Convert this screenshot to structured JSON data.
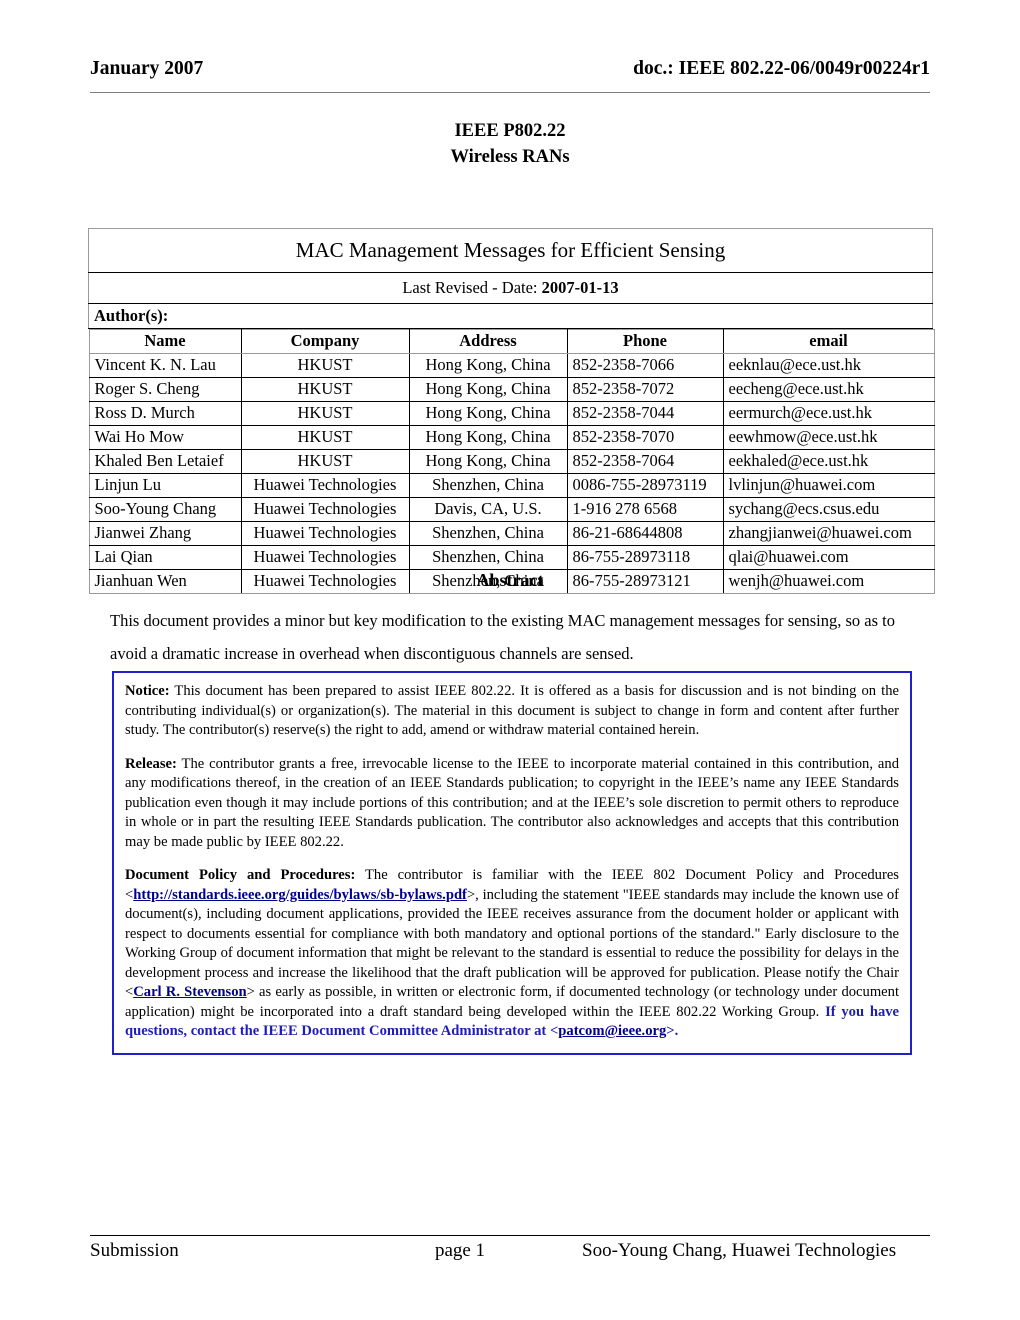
{
  "header": {
    "left": "January 2007",
    "right": "doc.: IEEE 802.22-06/0049r00224r1"
  },
  "series": {
    "line1": "IEEE P802.22",
    "line2": "Wireless RANs"
  },
  "title_block": {
    "title": "MAC Management Messages for Efficient Sensing",
    "revised_label": "Last Revised - Date: ",
    "revised_date": "2007-01-13",
    "authors_label": "Author(s):"
  },
  "authors_table": {
    "columns": [
      "Name",
      "Company",
      "Address",
      "Phone",
      "email"
    ],
    "rows": [
      [
        "Vincent K. N. Lau",
        "HKUST",
        "Hong Kong, China",
        "852-2358-7066",
        "eeknlau@ece.ust.hk"
      ],
      [
        "Roger S. Cheng",
        "HKUST",
        "Hong Kong, China",
        "852-2358-7072",
        "eecheng@ece.ust.hk"
      ],
      [
        "Ross D. Murch",
        "HKUST",
        "Hong Kong, China",
        "852-2358-7044",
        "eermurch@ece.ust.hk"
      ],
      [
        "Wai Ho Mow",
        "HKUST",
        "Hong Kong, China",
        "852-2358-7070",
        "eewhmow@ece.ust.hk"
      ],
      [
        "Khaled Ben Letaief",
        "HKUST",
        "Hong Kong, China",
        "852-2358-7064",
        "eekhaled@ece.ust.hk"
      ],
      [
        "Linjun Lu",
        "Huawei Technologies",
        "Shenzhen, China",
        "0086-755-28973119",
        "lvlinjun@huawei.com"
      ],
      [
        "Soo-Young Chang",
        "Huawei Technologies",
        "Davis, CA, U.S.",
        "1-916 278 6568",
        "sychang@ecs.csus.edu"
      ],
      [
        "Jianwei Zhang",
        "Huawei Technologies",
        "Shenzhen, China",
        "86-21-68644808",
        "zhangjianwei@huawei.com"
      ],
      [
        "Lai Qian",
        "Huawei Technologies",
        "Shenzhen, China",
        "86-755-28973118",
        "qlai@huawei.com"
      ],
      [
        "Jianhuan Wen",
        "Huawei Technologies",
        "Shenzhen, China",
        "86-755-28973121",
        "wenjh@huawei.com"
      ]
    ]
  },
  "abstract": {
    "heading": "Abstract",
    "body": "This document provides a minor but key modification to the existing MAC management messages for sensing, so as to avoid a dramatic increase in overhead when discontiguous channels are sensed."
  },
  "notice_box": {
    "notice_label": "Notice:",
    "notice_text": " This document has been prepared to assist IEEE 802.22. It is offered as a basis for discussion and is not binding on the contributing individual(s) or organization(s).  The material in this document is subject to change in form and content after further study. The contributor(s) reserve(s) the right to add, amend or withdraw material contained herein.",
    "release_label": "Release:",
    "release_text": " The contributor grants a free, irrevocable license to the IEEE to incorporate material contained in this contribution, and any modifications thereof, in the creation of an IEEE Standards publication; to copyright in the IEEE’s name any IEEE Standards publication even though it may include portions of this contribution; and at the IEEE’s sole discretion to permit others to reproduce in whole or in part the resulting IEEE Standards publication.  The contributor also acknowledges and accepts that this contribution may be made public by IEEE 802.22.",
    "policy_label": "Document Policy and Procedures:",
    "policy_text_1": " The contributor is familiar with the IEEE 802 Document Policy and Procedures <",
    "policy_link_bylaws": "http://standards.ieee.org/guides/bylaws/sb-bylaws.pdf",
    "policy_text_2": ">, including the statement \"IEEE standards may include the known use of document(s), including document applications, provided the IEEE receives assurance from the document holder or applicant with respect to documents essential for compliance with both mandatory and optional portions of the standard.\" Early disclosure to the Working Group of document information that might be relevant to the standard is essential to reduce the possibility for delays in the development process and increase the likelihood that the draft publication will be approved for publication.  Please notify the Chair <",
    "policy_link_chair": "Carl R. Stevenson",
    "policy_text_3": "> as early as possible, in written or electronic form, if documented technology (or technology under document application) might be incorporated into a draft standard being developed within the IEEE 802.22 Working Group. ",
    "policy_bold_blue": "If you have questions, contact the IEEE Document Committee Administrator at ",
    "policy_text_4": "<",
    "policy_link_patcom": "patcom@ieee.org",
    "policy_text_5": ">."
  },
  "footer": {
    "left": "Submission",
    "center": "page 1",
    "right": "Soo-Young Chang, Huawei Technologies"
  },
  "colors": {
    "link": "#00008B",
    "box_border": "#2020CC",
    "blue_bold": "#1E1EB4"
  }
}
